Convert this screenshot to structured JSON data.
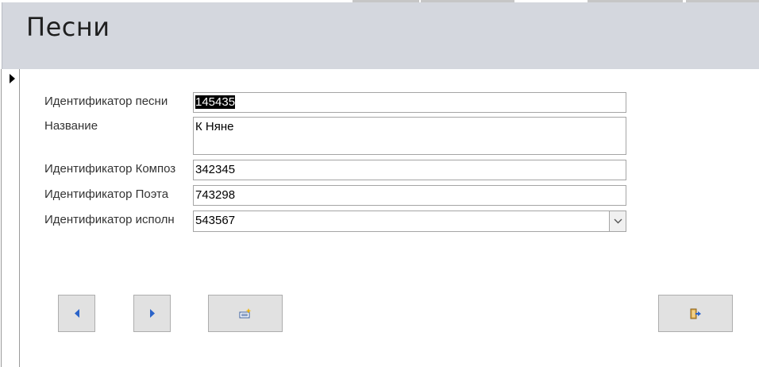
{
  "form": {
    "title": "Песни"
  },
  "fields": {
    "song_id": {
      "label": "Идентификатор песни",
      "value": "145435"
    },
    "name": {
      "label": "Название",
      "value": "К Няне"
    },
    "composer_id": {
      "label": "Идентификатор Композ",
      "value": "342345"
    },
    "poet_id": {
      "label": "Идентификатор Поэта",
      "value": "743298"
    },
    "performer_id": {
      "label": "Идентификатор исполн",
      "value": "543567"
    }
  },
  "buttons": {
    "prev": {
      "icon": "triangle-left-icon"
    },
    "next": {
      "icon": "triangle-right-icon"
    },
    "new_record": {
      "icon": "new-record-icon"
    },
    "close": {
      "icon": "close-form-icon"
    }
  },
  "colors": {
    "header_bg": "#d4d7de",
    "accent_blue": "#2a63c9"
  }
}
